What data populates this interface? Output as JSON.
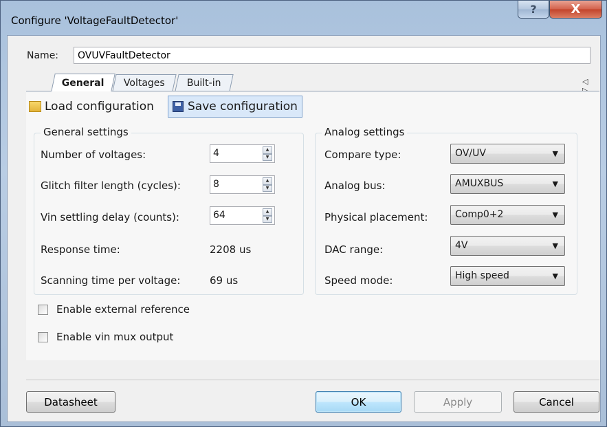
{
  "window": {
    "title": "Configure 'VoltageFaultDetector'",
    "help_glyph": "?",
    "close_glyph": "X"
  },
  "name": {
    "label": "Name:",
    "value": "OVUVFaultDetector"
  },
  "tabs": [
    {
      "label": "General",
      "active": true
    },
    {
      "label": "Voltages",
      "active": false
    },
    {
      "label": "Built-in",
      "active": false
    }
  ],
  "tab_scroll": "◁ ▷",
  "toolbar": {
    "load_label": "Load configuration",
    "save_label": "Save configuration"
  },
  "general": {
    "title": "General settings",
    "num_voltages": {
      "label": "Number of voltages:",
      "value": "4"
    },
    "glitch_filter": {
      "label": "Glitch filter length (cycles):",
      "value": "8"
    },
    "vin_settling": {
      "label": "Vin settling delay (counts):",
      "value": "64"
    },
    "response_time": {
      "label": "Response time:",
      "value": "2208 us"
    },
    "scanning_time": {
      "label": "Scanning time per voltage:",
      "value": "69 us"
    }
  },
  "analog": {
    "title": "Analog settings",
    "compare_type": {
      "label": "Compare type:",
      "value": "OV/UV"
    },
    "analog_bus": {
      "label": "Analog bus:",
      "value": "AMUXBUS"
    },
    "placement": {
      "label": "Physical placement:",
      "value": "Comp0+2"
    },
    "dac_range": {
      "label": "DAC range:",
      "value": "4V"
    },
    "speed_mode": {
      "label": "Speed mode:",
      "value": "High speed"
    }
  },
  "checkboxes": {
    "ext_ref": {
      "label": "Enable external reference",
      "checked": false
    },
    "vin_mux": {
      "label": "Enable vin mux output",
      "checked": false
    }
  },
  "buttons": {
    "datasheet": "Datasheet",
    "ok": "OK",
    "apply": "Apply",
    "cancel": "Cancel"
  }
}
